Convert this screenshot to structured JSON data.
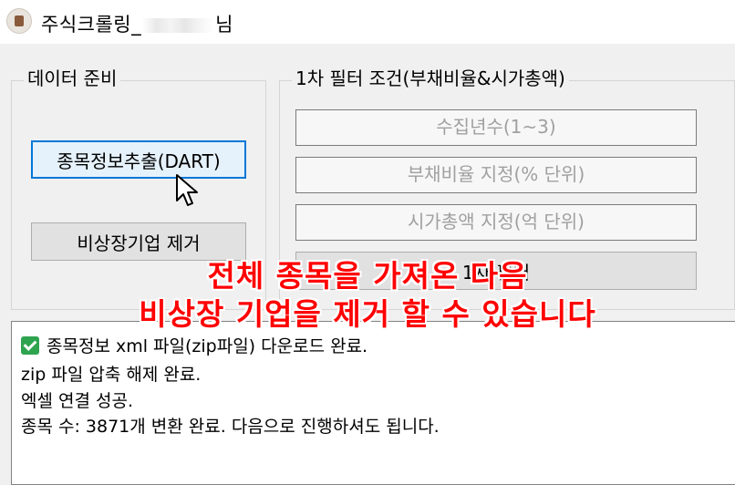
{
  "window": {
    "title_prefix": "주식크롤링_",
    "title_suffix": "님"
  },
  "data_prep": {
    "legend": "데이터 준비",
    "extract_button": "종목정보추출(DART)",
    "remove_unlisted_button": "비상장기업 제거"
  },
  "filter": {
    "legend": "1차 필터 조건(부채비율&시가총액)",
    "years_placeholder": "수집년수(1~3)",
    "debt_ratio_placeholder": "부채비율 지정(% 단위)",
    "market_cap_placeholder": "시가총액 지정(억 단위)",
    "apply_button": "1차 필터"
  },
  "overlay": {
    "line1": "전체 종목을 가져온 다음",
    "line2": "비상장 기업을 제거 할 수 있습니다",
    "color": "#ff0000"
  },
  "log": {
    "lines": [
      "종목정보 xml 파일(zip파일) 다운로드 완료.",
      "zip 파일 압축 해제 완료.",
      "엑셀 연결 성공.",
      "종목 수: 3871개 변환 완료. 다음으로 진행하셔도 됩니다."
    ]
  },
  "icons": {
    "app": "app-icon",
    "cursor": "mouse-pointer-icon",
    "check": "check-mark-icon"
  }
}
